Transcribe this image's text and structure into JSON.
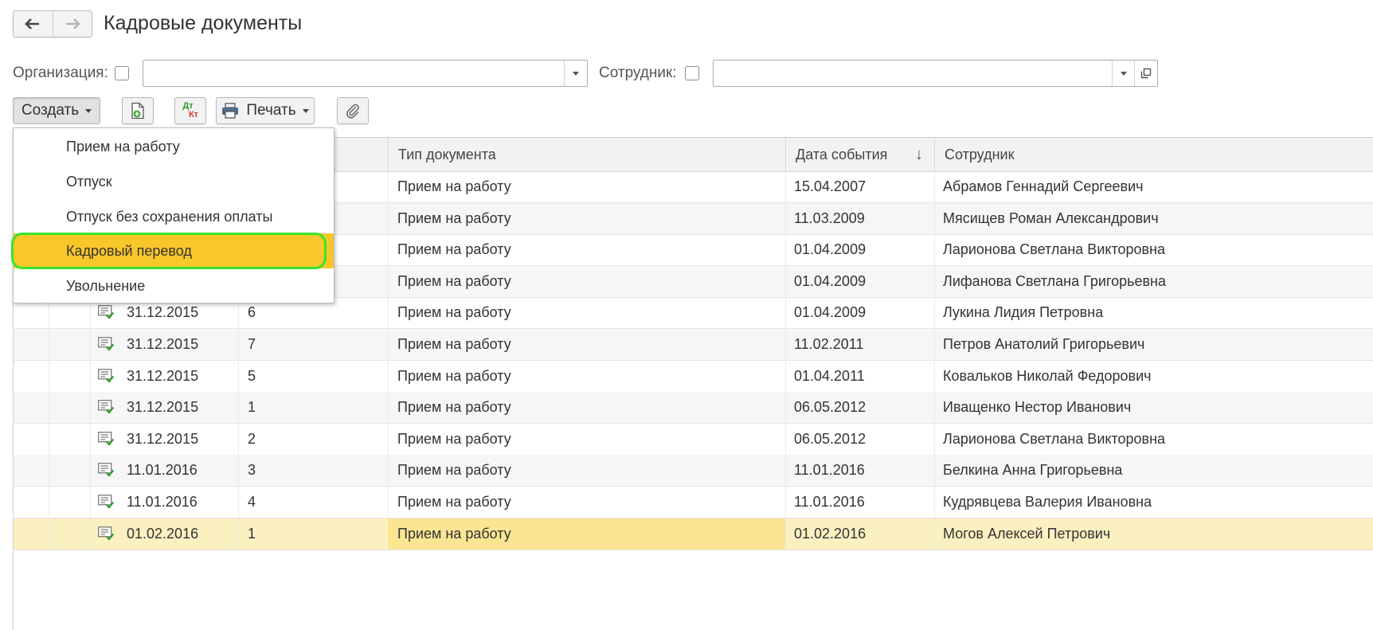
{
  "header": {
    "title": "Кадровые документы"
  },
  "filters": {
    "organization_label": "Организация:",
    "organization_value": "",
    "employee_label": "Сотрудник:",
    "employee_value": ""
  },
  "toolbar": {
    "create_label": "Создать",
    "print_label": "Печать",
    "dtkt_top": "Дт",
    "dtkt_bottom": "Кт"
  },
  "colors": {
    "menu_highlight": "#f8c72a",
    "focus_ring": "#39e52c",
    "selected_row": "#fbf0c0"
  },
  "table": {
    "columns": [
      "Тип документа",
      "Дата события",
      "Сотрудник"
    ],
    "sorted_column": "Дата события",
    "sort_direction": "desc",
    "rows": [
      {
        "date": "",
        "number": "",
        "type": "Прием на работу",
        "event_date": "15.04.2007",
        "employee": "Абрамов Геннадий Сергеевич"
      },
      {
        "date": "",
        "number": "",
        "type": "Прием на работу",
        "event_date": "11.03.2009",
        "employee": "Мясищев Роман Александрович"
      },
      {
        "date": "",
        "number": "",
        "type": "Прием на работу",
        "event_date": "01.04.2009",
        "employee": "Ларионова Светлана Викторовна"
      },
      {
        "date": "",
        "number": "",
        "type": "Прием на работу",
        "event_date": "01.04.2009",
        "employee": "Лифанова Светлана Григорьевна"
      },
      {
        "date": "31.12.2015",
        "number": "6",
        "type": "Прием на работу",
        "event_date": "01.04.2009",
        "employee": "Лукина Лидия Петровна"
      },
      {
        "date": "31.12.2015",
        "number": "7",
        "type": "Прием на работу",
        "event_date": "11.02.2011",
        "employee": "Петров Анатолий Григорьевич"
      },
      {
        "date": "31.12.2015",
        "number": "5",
        "type": "Прием на работу",
        "event_date": "01.04.2011",
        "employee": "Ковальков Николай Федорович"
      },
      {
        "date": "31.12.2015",
        "number": "1",
        "type": "Прием на работу",
        "event_date": "06.05.2012",
        "employee": "Иващенко Нестор Иванович"
      },
      {
        "date": "31.12.2015",
        "number": "2",
        "type": "Прием на работу",
        "event_date": "06.05.2012",
        "employee": "Ларионова Светлана Викторовна"
      },
      {
        "date": "11.01.2016",
        "number": "3",
        "type": "Прием на работу",
        "event_date": "11.01.2016",
        "employee": "Белкина Анна Григорьевна"
      },
      {
        "date": "11.01.2016",
        "number": "4",
        "type": "Прием на работу",
        "event_date": "11.01.2016",
        "employee": "Кудрявцева Валерия Ивановна"
      },
      {
        "date": "01.02.2016",
        "number": "1",
        "type": "Прием на работу",
        "event_date": "01.02.2016",
        "employee": "Могов Алексей Петрович"
      }
    ]
  },
  "create_menu": {
    "items": [
      "Прием на работу",
      "Отпуск",
      "Отпуск без сохранения оплаты",
      "Кадровый перевод",
      "Увольнение"
    ],
    "highlighted_index": 3
  }
}
